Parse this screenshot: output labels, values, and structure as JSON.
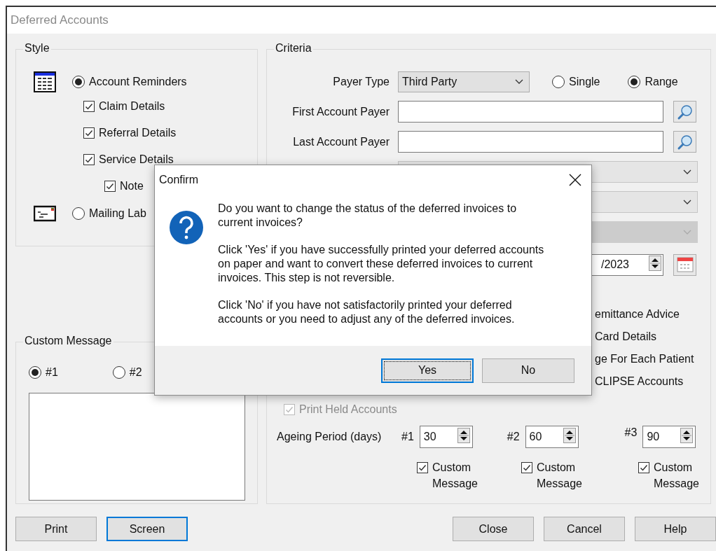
{
  "window": {
    "title": "Deferred Accounts"
  },
  "style": {
    "title": "Style",
    "options": [
      {
        "label": "Account Reminders",
        "selected": true,
        "kind": "table",
        "children": [
          {
            "label": "Claim Details",
            "checked": true
          },
          {
            "label": "Referral Details",
            "checked": true
          },
          {
            "label": "Service Details",
            "checked": true,
            "children": [
              {
                "label": "Note",
                "checked": true
              }
            ]
          }
        ]
      },
      {
        "label": "Mailing Lab",
        "selected": false,
        "kind": "envelope"
      }
    ]
  },
  "criteria": {
    "title": "Criteria",
    "payer_type": {
      "label": "Payer Type",
      "value": "Third Party"
    },
    "mode_options": [
      {
        "label": "Single",
        "selected": false
      },
      {
        "label": "Range",
        "selected": true
      }
    ],
    "fields": [
      {
        "label": "First Account Payer"
      },
      {
        "label": "Last Account Payer"
      }
    ],
    "dropdowns": [
      {
        "disabled": false
      },
      {
        "disabled": false
      },
      {
        "disabled": true
      }
    ],
    "date": {
      "value": "/2023"
    },
    "options": [
      {
        "label": "emittance Advice"
      },
      {
        "label": "Card Details"
      },
      {
        "label": "ge For Each Patient"
      },
      {
        "label": "CLIPSE Accounts"
      }
    ],
    "print_held": {
      "label": "Print Held Accounts",
      "checked": true,
      "disabled": true
    },
    "ageing": {
      "label": "Ageing Period (days)",
      "periods": [
        {
          "label": "#1",
          "value": "30",
          "custom_message": {
            "label": "Custom Message",
            "checked": true
          }
        },
        {
          "label": "#2",
          "value": "60",
          "custom_message": {
            "label": "Custom Message",
            "checked": true
          }
        },
        {
          "label": "#3",
          "value": "90",
          "custom_message": {
            "label": "Custom Message",
            "checked": true
          }
        }
      ]
    }
  },
  "custom_message": {
    "title": "Custom Message",
    "options": [
      {
        "label": "#1",
        "selected": true
      },
      {
        "label": "#2",
        "selected": false
      }
    ]
  },
  "buttons_left": [
    {
      "label": "Print",
      "focused": false
    },
    {
      "label": "Screen",
      "focused": true
    }
  ],
  "buttons_right": [
    {
      "label": "Close"
    },
    {
      "label": "Cancel"
    },
    {
      "label": "Help"
    }
  ],
  "dialog": {
    "title": "Confirm",
    "paragraphs": [
      "Do you want to change the status of the deferred invoices to current invoices?",
      "Click 'Yes' if you have successfully printed your deferred accounts on paper and want to convert these deferred invoices to current invoices. This step is not reversible.",
      "Click 'No' if you have not satisfactorily printed your deferred accounts or you need to adjust any of the deferred invoices."
    ],
    "buttons": [
      {
        "label": "Yes",
        "focused": true
      },
      {
        "label": "No",
        "focused": false
      }
    ]
  }
}
